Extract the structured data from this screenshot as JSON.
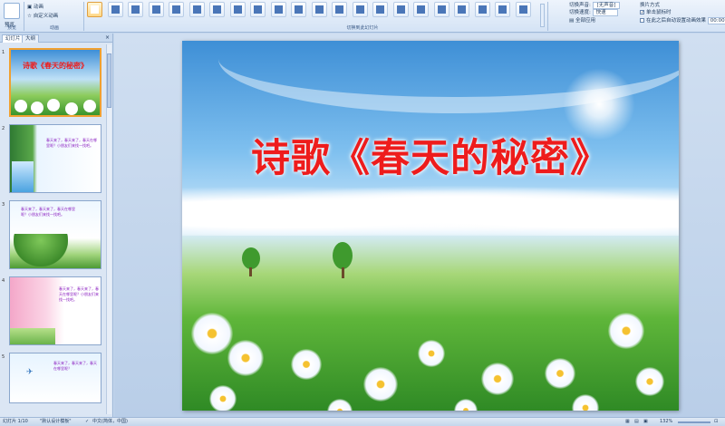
{
  "ribbon": {
    "preview_label": "预览",
    "preview_group_label": "预览",
    "anim_custom_label": "自定义动画",
    "anim_scheme_label": "动画",
    "anim_group_label": "动画",
    "transition_group_label": "切换到此幻灯片",
    "sound_label": "切换声音",
    "sound_value": "[无声音]",
    "speed_label": "切换速度",
    "speed_value": "快速",
    "apply_all_label": "全部应用",
    "advance_label": "换片方式",
    "on_click_label": "单击鼠标时",
    "after_time_label": "在此之后自动设置动画效果",
    "after_time_value": "00:00"
  },
  "left_panel": {
    "tab_slides": "幻灯片",
    "tab_outline": "大纲",
    "thumbs": [
      {
        "num": "1",
        "title": "诗歌《春天的秘密》",
        "selected": true
      },
      {
        "num": "2",
        "text": "春天来了，春天来了，春天在哪里呢？小朋友们来找一找吧。"
      },
      {
        "num": "3",
        "text": "春天来了，春天来了，春天在哪里呢？小朋友们来找一找吧。"
      },
      {
        "num": "4",
        "text": "春天来了，春天来了，春天在哪里呢？小朋友们来找一找吧。"
      },
      {
        "num": "5",
        "text": "春天来了，春天来了，春天在哪里呢？"
      }
    ]
  },
  "slide": {
    "title": "诗歌《春天的秘密》"
  },
  "status": {
    "slide_index": "幻灯片 1/10",
    "theme": "\"默认设计模板\"",
    "language": "中文(简体，中国)",
    "zoom": "132%"
  },
  "colors": {
    "title_red": "#ee1c1c",
    "selection_orange": "#f0a030",
    "ribbon_blue": "#d4e3f5"
  }
}
